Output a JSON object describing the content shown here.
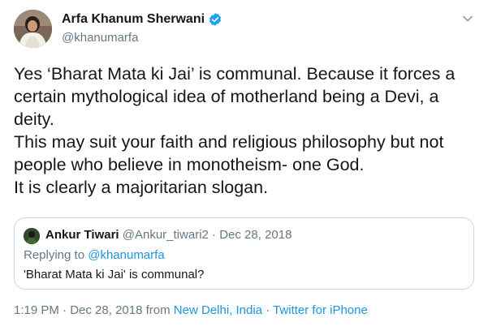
{
  "author": {
    "display_name": "Arfa Khanum Sherwani",
    "handle": "@khanumarfa"
  },
  "icons": {
    "verified": "verified-badge-icon",
    "caret": "chevron-down-icon"
  },
  "colors": {
    "link": "#1b95e0",
    "secondary_text": "#657786",
    "border": "#ccd6dd",
    "verified": "#1da1f2"
  },
  "tweet": {
    "lines": [
      "Yes ‘Bharat Mata ki Jai’ is communal. Because it forces a",
      "certain mythological idea of motherland being a Devi, a",
      "deity.",
      "This may suit your faith and religious philosophy but not",
      "people who believe in monotheism- one God.",
      "It is clearly a majoritarian slogan."
    ]
  },
  "quoted": {
    "display_name": "Ankur Tiwari",
    "handle": "@Ankur_tiwari2",
    "separator": "·",
    "date": "Dec 28, 2018",
    "replying_prefix": "Replying to",
    "replying_to": "@khanumarfa",
    "text": "'Bharat Mata ki Jai' is communal?"
  },
  "meta": {
    "time": "1:19 PM",
    "separator": "·",
    "date": "Dec 28, 2018",
    "from_label": "from",
    "location": "New Delhi, India",
    "source": "Twitter for iPhone"
  }
}
